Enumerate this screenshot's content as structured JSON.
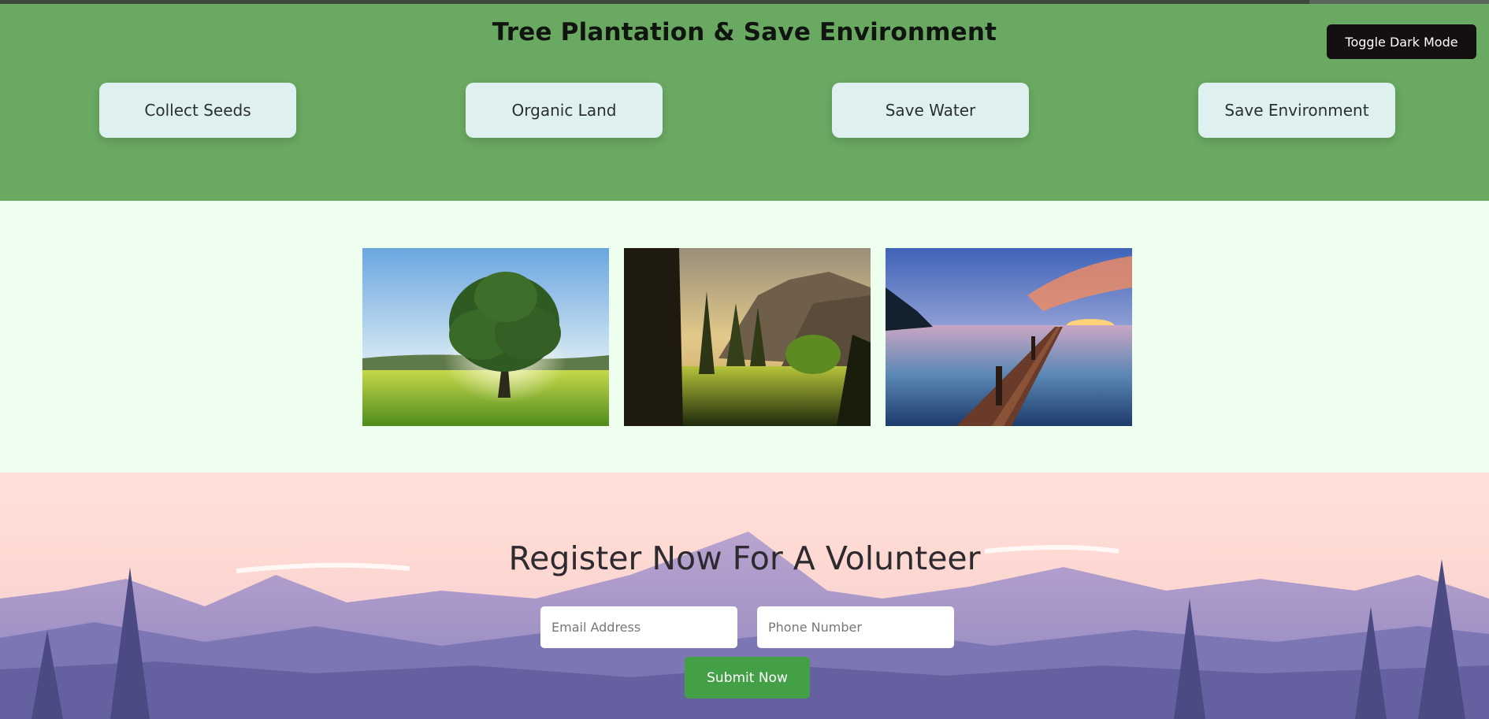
{
  "header": {
    "title": "Tree Plantation & Save Environment",
    "toggle_label": "Toggle Dark Mode",
    "features": [
      "Collect Seeds",
      "Organic Land",
      "Save Water",
      "Save Environment"
    ]
  },
  "gallery": {
    "images": [
      "tree-meadow",
      "forest-valley",
      "lake-pier-sunset"
    ]
  },
  "register": {
    "title": "Register Now For A Volunteer",
    "email_placeholder": "Email Address",
    "phone_placeholder": "Phone Number",
    "submit_label": "Submit Now"
  },
  "colors": {
    "header_bg": "#6aa961",
    "card_bg": "#dff0f0",
    "gallery_bg": "#eeffef",
    "toggle_bg": "#140f10",
    "submit_bg": "#43a047"
  }
}
